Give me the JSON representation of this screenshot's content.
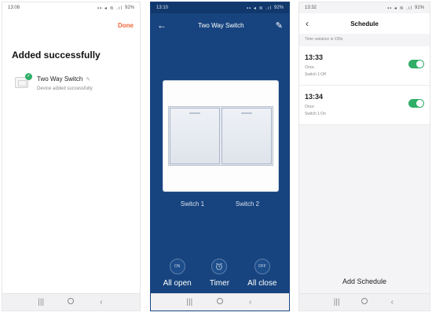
{
  "screen1": {
    "status_time": "13:08",
    "status_battery": "92%",
    "done_label": "Done",
    "title": "Added successfully",
    "device_name": "Two Way Switch",
    "device_status": "Device added successfully"
  },
  "screen2": {
    "status_time": "13:10",
    "status_battery": "92%",
    "header_title": "Two Way Switch",
    "switch1_label": "Switch 1",
    "switch2_label": "Switch 2",
    "all_open_icon": "ON",
    "all_open_label": "All open",
    "timer_label": "Timer",
    "all_close_icon": "OFF",
    "all_close_label": "All close"
  },
  "screen3": {
    "status_time": "13:32",
    "status_battery": "91%",
    "header_title": "Schedule",
    "note": "Time variance is ±30s",
    "items": [
      {
        "time": "13:33",
        "repeat": "Once",
        "action": "Switch 1:Off",
        "enabled": true
      },
      {
        "time": "13:34",
        "repeat": "Once",
        "action": "Switch 1:On",
        "enabled": true
      }
    ],
    "add_label": "Add Schedule"
  },
  "icons": {
    "back": "arrow-left-icon",
    "edit": "pencil-icon",
    "timer": "alarm-clock-icon",
    "success": "check-circle-icon",
    "nav_recents": "recents-icon",
    "nav_home": "home-icon",
    "nav_back": "back-chevron-icon"
  },
  "colors": {
    "accent_orange": "#f0673b",
    "brand_blue": "#17447f",
    "toggle_green": "#2fae67"
  }
}
